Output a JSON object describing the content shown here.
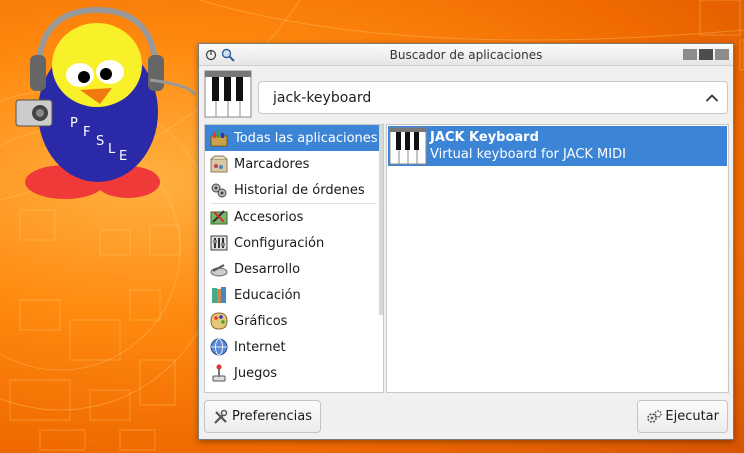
{
  "window": {
    "title": "Buscador de aplicaciones"
  },
  "search": {
    "value": "jack-keyboard"
  },
  "categories": [
    {
      "label": "Todas las aplicaciones",
      "icon": "all-apps-icon"
    },
    {
      "label": "Marcadores",
      "icon": "bookmarks-icon"
    },
    {
      "label": "Historial de órdenes",
      "icon": "history-icon"
    },
    {
      "label": "Accesorios",
      "icon": "accessories-icon"
    },
    {
      "label": "Configuración",
      "icon": "settings-icon"
    },
    {
      "label": "Desarrollo",
      "icon": "development-icon"
    },
    {
      "label": "Educación",
      "icon": "education-icon"
    },
    {
      "label": "Gráficos",
      "icon": "graphics-icon"
    },
    {
      "label": "Internet",
      "icon": "internet-icon"
    },
    {
      "label": "Juegos",
      "icon": "games-icon"
    }
  ],
  "results": [
    {
      "name": "JACK Keyboard",
      "description": "Virtual keyboard for JACK MIDI",
      "icon": "piano-keyboard-icon"
    }
  ],
  "footer": {
    "preferences_label": "Preferencias",
    "run_label": "Ejecutar"
  },
  "mascot_text": "PFSLE",
  "colors": {
    "selection": "#3b84d6",
    "wallpaper": "#f07a10"
  }
}
